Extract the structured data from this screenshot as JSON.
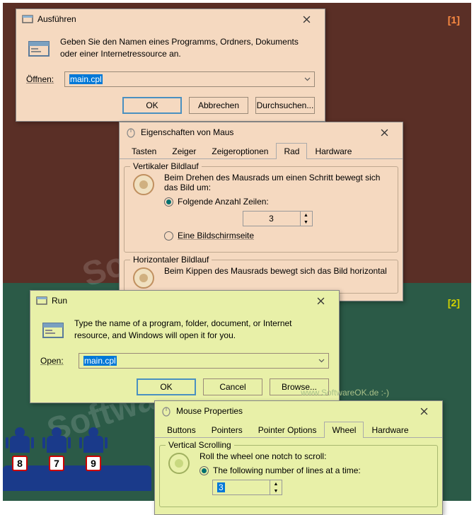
{
  "markers": {
    "one": "[1]",
    "two": "[2]"
  },
  "url_text": "www.SoftwareOK.de :-)",
  "watermark": "SoftwareOK.de",
  "run_de": {
    "title": "Ausführen",
    "desc": "Geben Sie den Namen eines Programms, Ordners, Dokuments oder einer Internetressource an.",
    "open_label": "Öffnen:",
    "value": "main.cpl",
    "ok": "OK",
    "cancel": "Abbrechen",
    "browse": "Durchsuchen..."
  },
  "mouse_de": {
    "title": "Eigenschaften von Maus",
    "tabs": [
      "Tasten",
      "Zeiger",
      "Zeigeroptionen",
      "Rad",
      "Hardware"
    ],
    "active_tab": 3,
    "vgroup": "Vertikaler Bildlauf",
    "vtext": "Beim Drehen des Mausrads um einen Schritt bewegt sich das Bild um:",
    "radio_lines": "Folgende Anzahl Zeilen:",
    "lines_value": "3",
    "radio_screen": "Eine Bildschirmseite",
    "hgroup": "Horizontaler Bildlauf",
    "htext": "Beim Kippen des Mausrads bewegt sich das Bild horizontal"
  },
  "run_en": {
    "title": "Run",
    "desc": "Type the name of a program, folder, document, or Internet resource, and Windows will open it for you.",
    "open_label": "Open:",
    "value": "main.cpl",
    "ok": "OK",
    "cancel": "Cancel",
    "browse": "Browse..."
  },
  "mouse_en": {
    "title": "Mouse Properties",
    "tabs": [
      "Buttons",
      "Pointers",
      "Pointer Options",
      "Wheel",
      "Hardware"
    ],
    "active_tab": 3,
    "vgroup": "Vertical Scrolling",
    "vtext": "Roll the wheel one notch to scroll:",
    "radio_lines": "The following number of lines at a time:",
    "lines_value": "3"
  },
  "judges": [
    "8",
    "7",
    "9"
  ]
}
